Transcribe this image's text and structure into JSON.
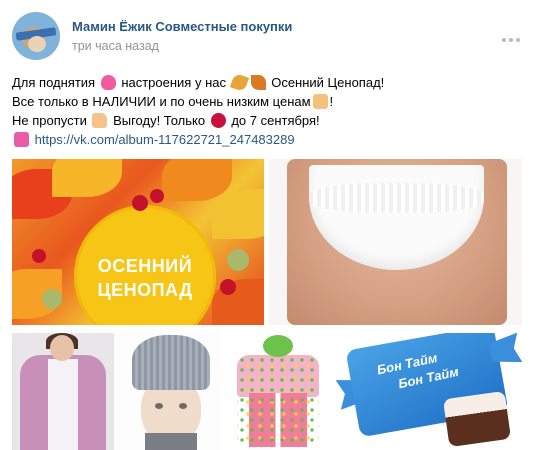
{
  "post": {
    "author": "Мамин Ёжик Совместные покупки",
    "time": "три часа назад",
    "text_lines": [
      [
        "Для поднятия ",
        " настроения у нас ",
        " Осенний Ценопад!"
      ],
      [
        "Все только в НАЛИЧИИ и по очень низким ценам",
        "!"
      ],
      [
        "Не пропусти ",
        " Выгоду! Только ",
        " до 7 сентября!"
      ]
    ],
    "link": "https://vk.com/album-117622721_247483289"
  },
  "photos": {
    "autumn_banner_text_1": "ОСЕННИЙ",
    "autumn_banner_text_2": "ЦЕНОПАД",
    "candy_brand_1": "Бон Тайм",
    "candy_brand_2": "Бон Тайм"
  },
  "icons": {
    "more": "more-horizontal-icon",
    "heart": "sparkling-heart-icon",
    "leaves": "autumn-leaves-icon",
    "thumb": "thumbs-up-icon",
    "point": "pointing-hand-icon",
    "lips": "lips-icon",
    "box_heart": "heart-box-icon"
  },
  "colors": {
    "link": "#2a5885",
    "meta": "#939393"
  }
}
